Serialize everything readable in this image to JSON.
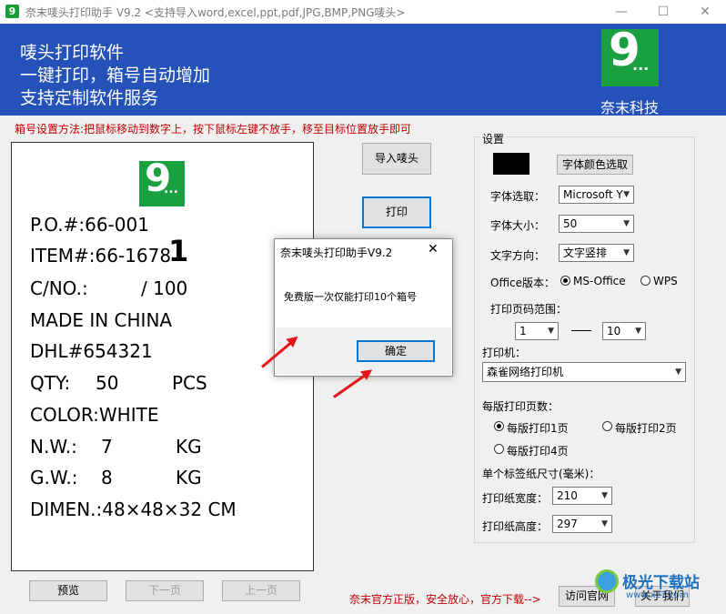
{
  "window": {
    "title": "奈末唛头打印助手  V9.2     <支持导入word,excel,ppt,pdf,JPG,BMP,PNG唛头>",
    "minimize": "—",
    "maximize": "☐",
    "close": "✕"
  },
  "banner": {
    "lines": [
      "唛头打印软件",
      "一键打印，箱号自动增加",
      "支持定制软件服务"
    ],
    "logo_digit": "9",
    "logo_dots": "...",
    "company": "奈末科技"
  },
  "instruction": "箱号设置方法:把鼠标移动到数字上，按下鼠标左键不放手，移至目标位置放手即可",
  "label": {
    "po": "P.O.#:66-001",
    "item": "ITEM#:66-1678",
    "box_number": "1",
    "cno_prefix": "C/NO.:",
    "cno_total": "/ 100",
    "made_in": "MADE    IN CHINA",
    "dhl": "DHL#654321",
    "qty_label": "QTY:",
    "qty_value": "50",
    "qty_unit": "PCS",
    "color": "COLOR:WHITE",
    "nw_label": "N.W.:",
    "nw_value": "7",
    "nw_unit": "KG",
    "gw_label": "G.W.:",
    "gw_value": "8",
    "gw_unit": "KG",
    "dimen": "DIMEN.:48×48×32 CM"
  },
  "buttons": {
    "import": "导入唛头",
    "print": "打印",
    "preview": "预览",
    "next_page": "下一页",
    "prev_page": "上一页",
    "visit_site": "访问官网",
    "about": "关于我们"
  },
  "settings": {
    "group_title": "设置",
    "font_color_button": "字体颜色选取",
    "font_select_label": "字体选取：",
    "font_select_value": "Microsoft Y",
    "font_size_label": "字体大小：",
    "font_size_value": "50",
    "text_direction_label": "文字方向：",
    "text_direction_value": "文字竖排",
    "office_version_label": "Office版本：",
    "office_option_ms": "MS-Office",
    "office_option_wps": "WPS",
    "page_range_label": "打印页码范围：",
    "page_from": "1",
    "page_to": "10",
    "printer_label": "打印机：",
    "printer_value": "森雀网络打印机",
    "pages_per_sheet_label": "每版打印页数：",
    "pps_1": "每版打印1页",
    "pps_2": "每版打印2页",
    "pps_4": "每版打印4页",
    "label_size_label": "单个标签纸尺寸(毫米)：",
    "width_label": "打印纸宽度：",
    "width_value": "210",
    "height_label": "打印纸高度：",
    "height_value": "297"
  },
  "dialog": {
    "title": "奈末唛头打印助手V9.2",
    "message": "免费版一次仅能打印10个箱号",
    "ok": "确定",
    "close": "✕"
  },
  "footer_text": "奈末官方正版，安全放心，官方下载-->",
  "watermark": {
    "text": "极光下载站",
    "url": "www.xz7.com"
  },
  "colors": {
    "banner": "#2552b8",
    "logo_green": "#1aa040",
    "arrow_red": "#e5141b",
    "warning_text": "#c00000"
  }
}
